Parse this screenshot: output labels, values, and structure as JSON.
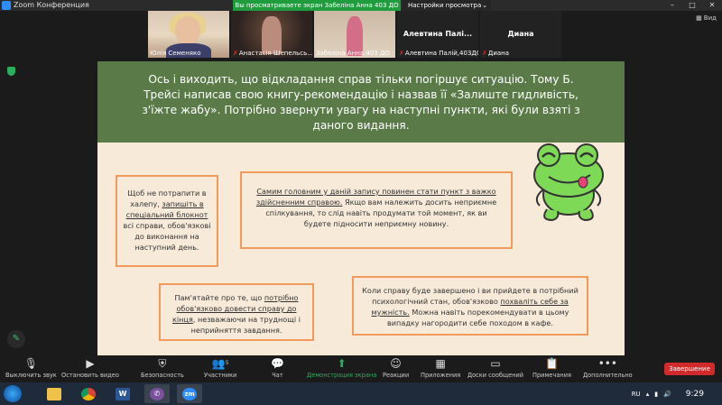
{
  "window": {
    "title": "Zoom Конференция",
    "share_banner": "Вы просматриваете экран Забеліна  Анна 403 ДО",
    "view_settings": "Настройки просмотра",
    "view_button": "Вид"
  },
  "gallery": [
    {
      "name": "Юлія Семеняко",
      "muted": false
    },
    {
      "name": "Анастасія Шепельсь...",
      "muted": true
    },
    {
      "name": "Забеліна  Анна 403 ДО",
      "muted": false
    },
    {
      "name": "Алевтина Палій,403ДО",
      "muted": true,
      "center": "Алевтина  Палі..."
    },
    {
      "name": "Диана",
      "muted": true,
      "center": "Диана"
    }
  ],
  "slide": {
    "title": "Ось і виходить, що відкладання справ тільки погіршує ситуацію. Тому Б. Трейсі написав свою книгу-рекомендацію і назвав її «Залиште гидливість, з'їжте жабу». Потрібно звернути увагу на наступні пункти, які були взяті з даного видання.",
    "note1_a": "Щоб не потрапити в халепу, ",
    "note1_u": "запишіть в спеціальний блокнот",
    "note1_b": " всі справи, обов'язкові до виконання на наступний день.",
    "note2_u": "Самим головним у даній запису повинен стати пункт з важко здійсненним справою.",
    "note2_b": " Якщо вам належить досить неприємне спілкування, то слід навіть продумати той момент, як ви будете підносити неприємну новину.",
    "note3_a": "Пам'ятайте про те, що ",
    "note3_u": "потрібно обов'язково довести справу до кінця",
    "note3_b": ", незважаючи на труднощі і неприйняття завдання.",
    "note4_a": "Коли справу буде завершено і ви прийдете в потрібний психологічний стан, обов'язково ",
    "note4_u": "похваліть себе за мужність.",
    "note4_b": " Можна навіть порекомендувати в цьому випадку нагородити себе походом в кафе."
  },
  "toolbar": {
    "mute": "Выключить звук",
    "video": "Остановить видео",
    "security": "Безопасность",
    "participants": "Участники",
    "participants_count": "5",
    "chat": "Чат",
    "share": "Демонстрация экрана",
    "reactions": "Реакции",
    "apps": "Приложения",
    "whiteboards": "Доски сообщений",
    "notes": "Примечания",
    "more": "Дополнительно",
    "end": "Завершение"
  },
  "taskbar": {
    "lang": "RU",
    "clock": "9:29",
    "apps": [
      "explorer",
      "chrome",
      "word",
      "viber",
      "zoom"
    ]
  }
}
